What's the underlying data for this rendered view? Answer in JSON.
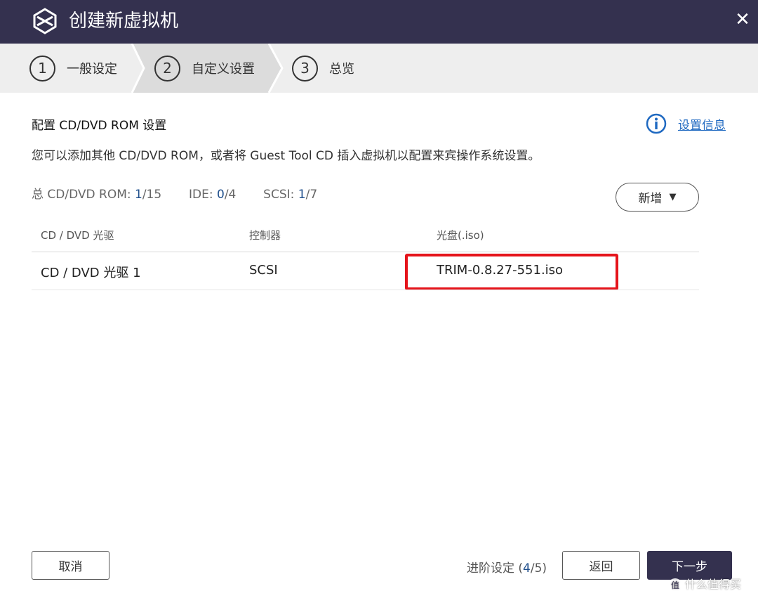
{
  "window": {
    "title": "创建新虚拟机",
    "logo_icon": "vm-logo-icon",
    "close_icon": "close-icon",
    "close_glyph": "✕"
  },
  "steps": [
    {
      "num": "1",
      "label": "一般设定",
      "active": false
    },
    {
      "num": "2",
      "label": "自定义设置",
      "active": true
    },
    {
      "num": "3",
      "label": "总览",
      "active": false
    }
  ],
  "section": {
    "title": "配置 CD/DVD ROM 设置",
    "info_icon": "info-icon",
    "info_link": "设置信息",
    "description": "您可以添加其他 CD/DVD ROM，或者将 Guest Tool CD 插入虚拟机以配置来宾操作系统设置。"
  },
  "counts": {
    "total_label": "总 CD/DVD ROM: ",
    "total_used": "1",
    "total_max": "/15",
    "ide_label": "IDE: ",
    "ide_used": "0",
    "ide_max": "/4",
    "scsi_label": "SCSI: ",
    "scsi_used": "1",
    "scsi_max": "/7"
  },
  "add_button": {
    "label": "新增",
    "caret": "▼"
  },
  "table": {
    "headers": [
      "CD / DVD 光驱",
      "控制器",
      "光盘(.iso)"
    ],
    "rows": [
      {
        "drive": "CD / DVD 光驱 1",
        "controller": "SCSI",
        "iso": "TRIM-0.8.27-551.iso"
      }
    ]
  },
  "footer": {
    "cancel": "取消",
    "progress_label": "进阶设定 (",
    "progress_current": "4",
    "progress_total": "/5",
    "progress_close": ")",
    "back": "返回",
    "next": "下一步"
  },
  "watermark": {
    "icon_glyph": "值",
    "text": "什么值得买"
  },
  "colors": {
    "titlebar": "#34314f",
    "link": "#1f69c1",
    "highlight": "#e5141b",
    "primary_button": "#34314f"
  }
}
